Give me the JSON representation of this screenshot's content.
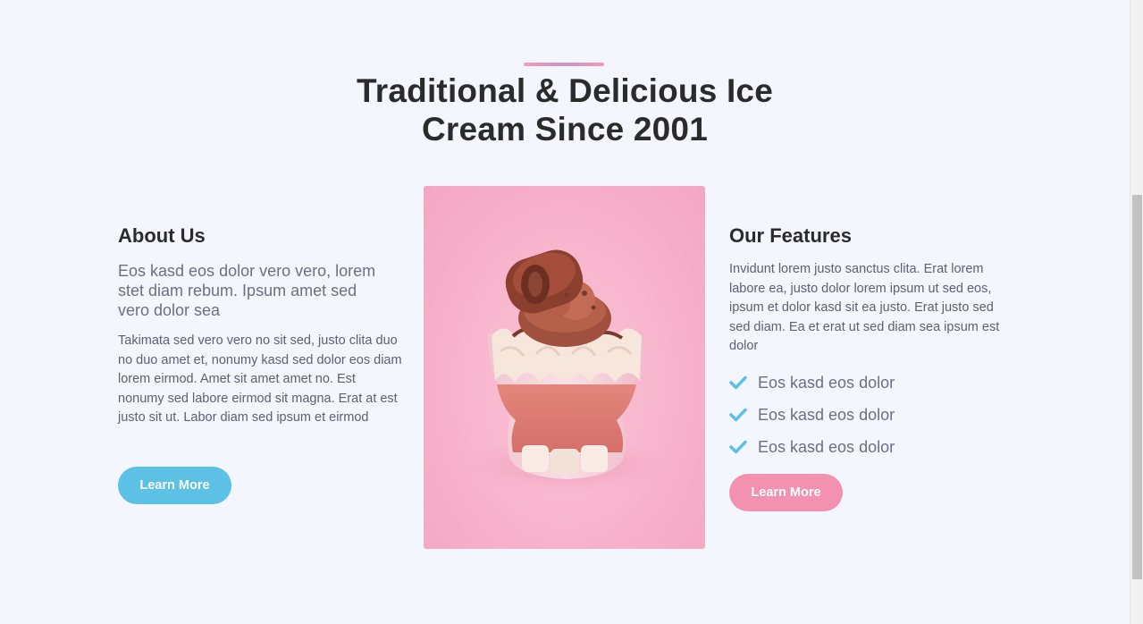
{
  "header": {
    "title_line1": "Traditional & Delicious Ice",
    "title_line2": "Cream Since 2001"
  },
  "about": {
    "heading": "About Us",
    "lead": "Eos kasd eos dolor vero vero, lorem stet diam rebum. Ipsum amet sed vero dolor sea",
    "body": "Takimata sed vero vero no sit sed, justo clita duo no duo amet et, nonumy kasd sed dolor eos diam lorem eirmod. Amet sit amet amet no. Est nonumy sed labore eirmod sit magna. Erat at est justo sit ut. Labor diam sed ipsum et eirmod",
    "button_label": "Learn More"
  },
  "image": {
    "subject": "ice-cream-dessert-cup"
  },
  "features": {
    "heading": "Our Features",
    "body": "Invidunt lorem justo sanctus clita. Erat lorem labore ea, justo dolor lorem ipsum ut sed eos, ipsum et dolor kasd sit ea justo. Erat justo sed sed diam. Ea et erat ut sed diam sea ipsum est dolor",
    "items": [
      {
        "label": "Eos kasd eos dolor",
        "icon": "check-icon"
      },
      {
        "label": "Eos kasd eos dolor",
        "icon": "check-icon"
      },
      {
        "label": "Eos kasd eos dolor",
        "icon": "check-icon"
      }
    ],
    "button_label": "Learn More"
  },
  "colors": {
    "background": "#f4f6fe",
    "accent_blue": "#5cc1e4",
    "accent_pink": "#f292b0",
    "heading": "#2b2b2b",
    "text": "#5d606f"
  }
}
